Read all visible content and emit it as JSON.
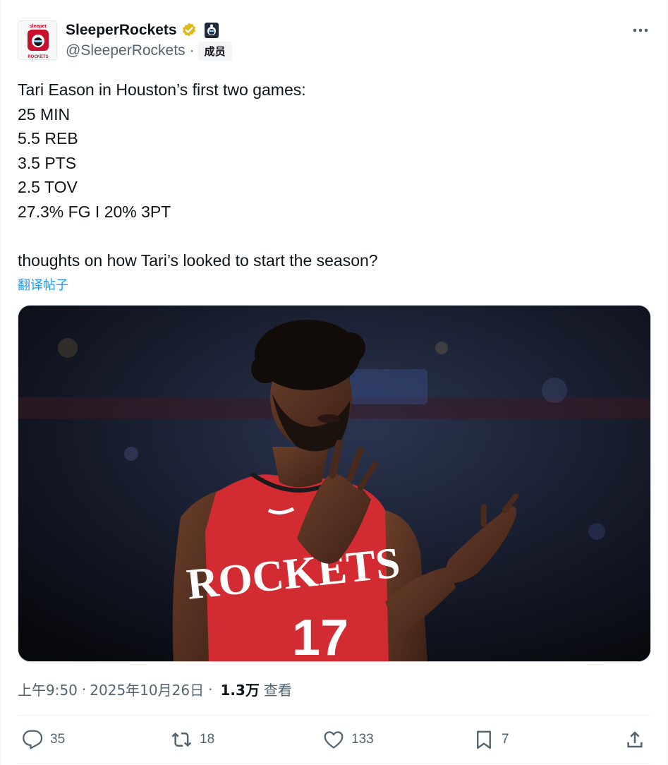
{
  "author": {
    "display_name": "SleeperRockets",
    "handle": "@SleeperRockets",
    "member_tag": "成员",
    "avatar_text_top": "sleeper",
    "avatar_text_bottom": "ROCKETS",
    "verified_badge_color": "#e2b719"
  },
  "tweet": {
    "text": "Tari Eason in Houston’s first two games:\n25 MIN\n5.5 REB\n3.5 PTS\n2.5 TOV\n27.3% FG I 20% 3PT\n\nthoughts on how Tari’s looked to start the season?",
    "translate_label": "翻译帖子",
    "jersey_text": "ROCKETS",
    "jersey_number": "17"
  },
  "meta": {
    "time": "上午9:50",
    "date": "2025年10月26日",
    "views_count": "1.3万",
    "views_label": "查看"
  },
  "actions": {
    "reply_count": "35",
    "repost_count": "18",
    "like_count": "133",
    "bookmark_count": "7"
  },
  "colors": {
    "accent": "#1d9bf0",
    "secondary_text": "#536471",
    "jersey_red": "#d22b32"
  }
}
